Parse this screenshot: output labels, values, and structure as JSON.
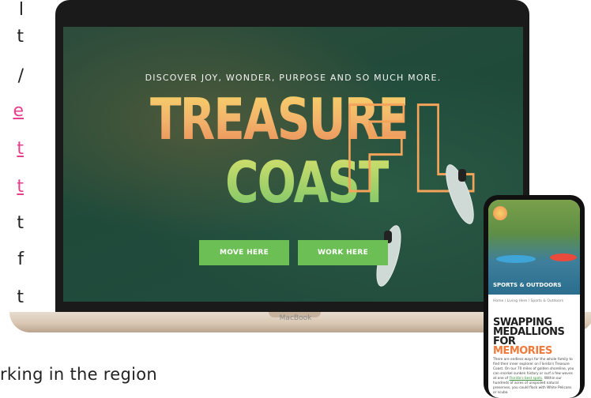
{
  "left_column": {
    "lines": [
      {
        "text": "l",
        "link": false
      },
      {
        "text": "t",
        "link": false
      },
      {
        "text": "/",
        "link": false
      },
      {
        "text": "e",
        "link": true
      },
      {
        "text": "t",
        "link": true
      },
      {
        "text": "t",
        "link": true
      },
      {
        "text": "t",
        "link": false
      },
      {
        "text": "f",
        "link": false
      },
      {
        "text": "t",
        "link": false
      }
    ],
    "caption": "rking in the region"
  },
  "laptop": {
    "tagline": "DISCOVER JOY, WONDER, PURPOSE AND SO MUCH MORE.",
    "title_line1": "TREASURE",
    "title_line2": "COAST",
    "title_fl": "FL",
    "buttons": [
      {
        "label": "MOVE HERE"
      },
      {
        "label": "WORK HERE"
      }
    ],
    "brand": "MacBook",
    "accent_color": "#6cbf55"
  },
  "phone": {
    "hero_title": "SPORTS & OUTDOORS",
    "breadcrumb": "Home / Living Here / Sports & Outdoors",
    "headline_line1": "SWAPPING",
    "headline_line2": "MEDALLIONS FOR",
    "headline_accent": "MEMORIES",
    "body_pre": "There are endless ways for the whole family to find their inner explorer on Florida's Treasure Coast. On our 70 miles of golden shoreline, you can snorkel sunken history or surf a few waves at one of ",
    "body_link": "Florida's best spots",
    "body_post": ". Within our hundreds of acres of unspoiled natural preserves, you could flock with White Pelicans or scuba",
    "accent_color": "#f07a3a"
  }
}
